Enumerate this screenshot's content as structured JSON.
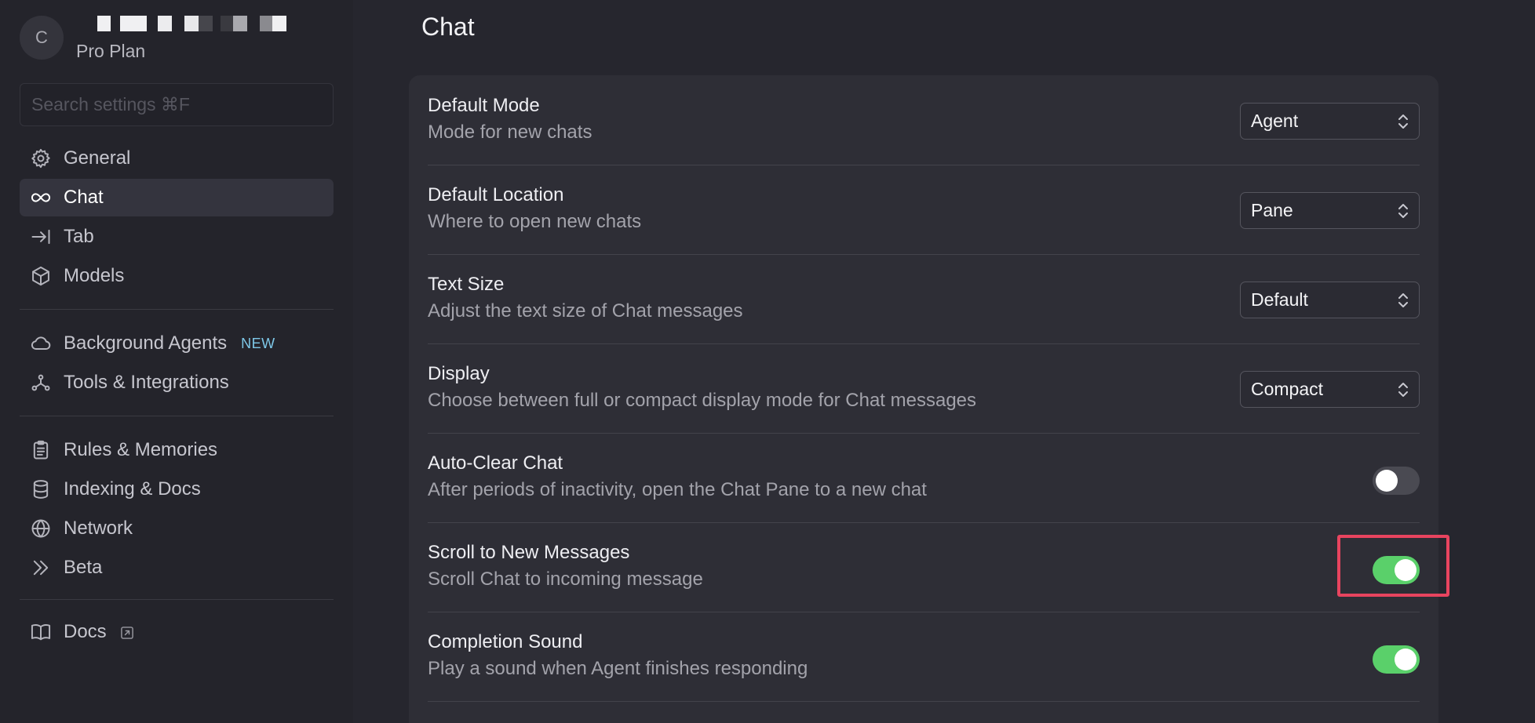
{
  "user": {
    "avatar_initial": "C",
    "plan": "Pro Plan"
  },
  "search": {
    "placeholder": "Search settings ⌘F"
  },
  "nav": {
    "general": "General",
    "chat": "Chat",
    "tab": "Tab",
    "models": "Models",
    "background_agents": "Background Agents",
    "background_agents_badge": "NEW",
    "tools": "Tools & Integrations",
    "rules": "Rules & Memories",
    "indexing": "Indexing & Docs",
    "network": "Network",
    "beta": "Beta",
    "docs": "Docs"
  },
  "page": {
    "title": "Chat"
  },
  "settings": [
    {
      "title": "Default Mode",
      "description": "Mode for new chats",
      "control": "select",
      "value": "Agent"
    },
    {
      "title": "Default Location",
      "description": "Where to open new chats",
      "control": "select",
      "value": "Pane"
    },
    {
      "title": "Text Size",
      "description": "Adjust the text size of Chat messages",
      "control": "select",
      "value": "Default"
    },
    {
      "title": "Display",
      "description": "Choose between full or compact display mode for Chat messages",
      "control": "select",
      "value": "Compact"
    },
    {
      "title": "Auto-Clear Chat",
      "description": "After periods of inactivity, open the Chat Pane to a new chat",
      "control": "toggle",
      "on": false
    },
    {
      "title": "Scroll to New Messages",
      "description": "Scroll Chat to incoming message",
      "control": "toggle",
      "on": true
    },
    {
      "title": "Completion Sound",
      "description": "Play a sound when Agent finishes responding",
      "control": "toggle",
      "on": true
    }
  ],
  "colors": {
    "toggle_on": "#5ad06a",
    "toggle_off": "#4a4a52",
    "highlight": "#e8445f",
    "badge_new": "#7ec8e8"
  }
}
